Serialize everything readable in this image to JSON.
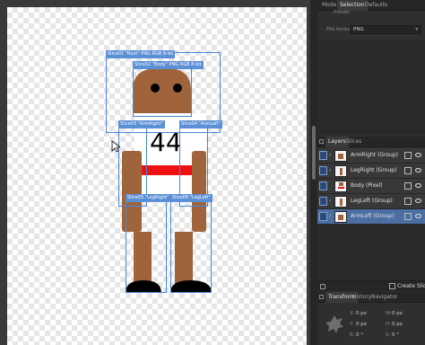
{
  "panel": {
    "top_tabs": [
      "Mode",
      "Selection",
      "Defaults"
    ],
    "preset_label": "Preset:",
    "file_format_label": "File format:",
    "file_format_value": "PNG",
    "layers_tabs": [
      "Layers",
      "Slices"
    ],
    "layers": [
      {
        "name": "ArmRight (Group)",
        "selected": true
      },
      {
        "name": "LegRight (Group)",
        "selected": false
      },
      {
        "name": "Body (Pixel)",
        "selected": false
      },
      {
        "name": "LegLeft (Group)",
        "selected": false
      },
      {
        "name": "ArmLeft (Group)",
        "selected": true
      }
    ],
    "create_slice_label": "Create Slice",
    "bottom_tabs": [
      "Transform",
      "History",
      "Navigator"
    ],
    "transform": {
      "x_label": "X:",
      "x_value": "0 px",
      "y_label": "Y:",
      "y_value": "0 px",
      "w_label": "W:",
      "w_value": "0 px",
      "h_label": "H:",
      "h_value": "0 px",
      "r_label": "R:",
      "r_value": "0 °",
      "s_label": "S:",
      "s_value": "0 °"
    }
  },
  "canvas": {
    "jersey_number": "44",
    "slices": {
      "root": "Slice01 \"Root\" PNG RGB 8-bit",
      "body": "Slice02 \"Body\" PNG RGB 8-bit",
      "arm_right": "Slice03 \"ArmRight\"",
      "arm_left": "Slice04 \"ArmLeft\"",
      "leg_right": "Slice05 \"LegRight\"",
      "leg_left": "Slice06 \"LegLeft\""
    }
  },
  "colors": {
    "skin": "#a0643c",
    "stripe": "#ee1111",
    "shoe": "#000000",
    "shirt": "#ffffff",
    "selection_blue": "#4a86d8"
  }
}
